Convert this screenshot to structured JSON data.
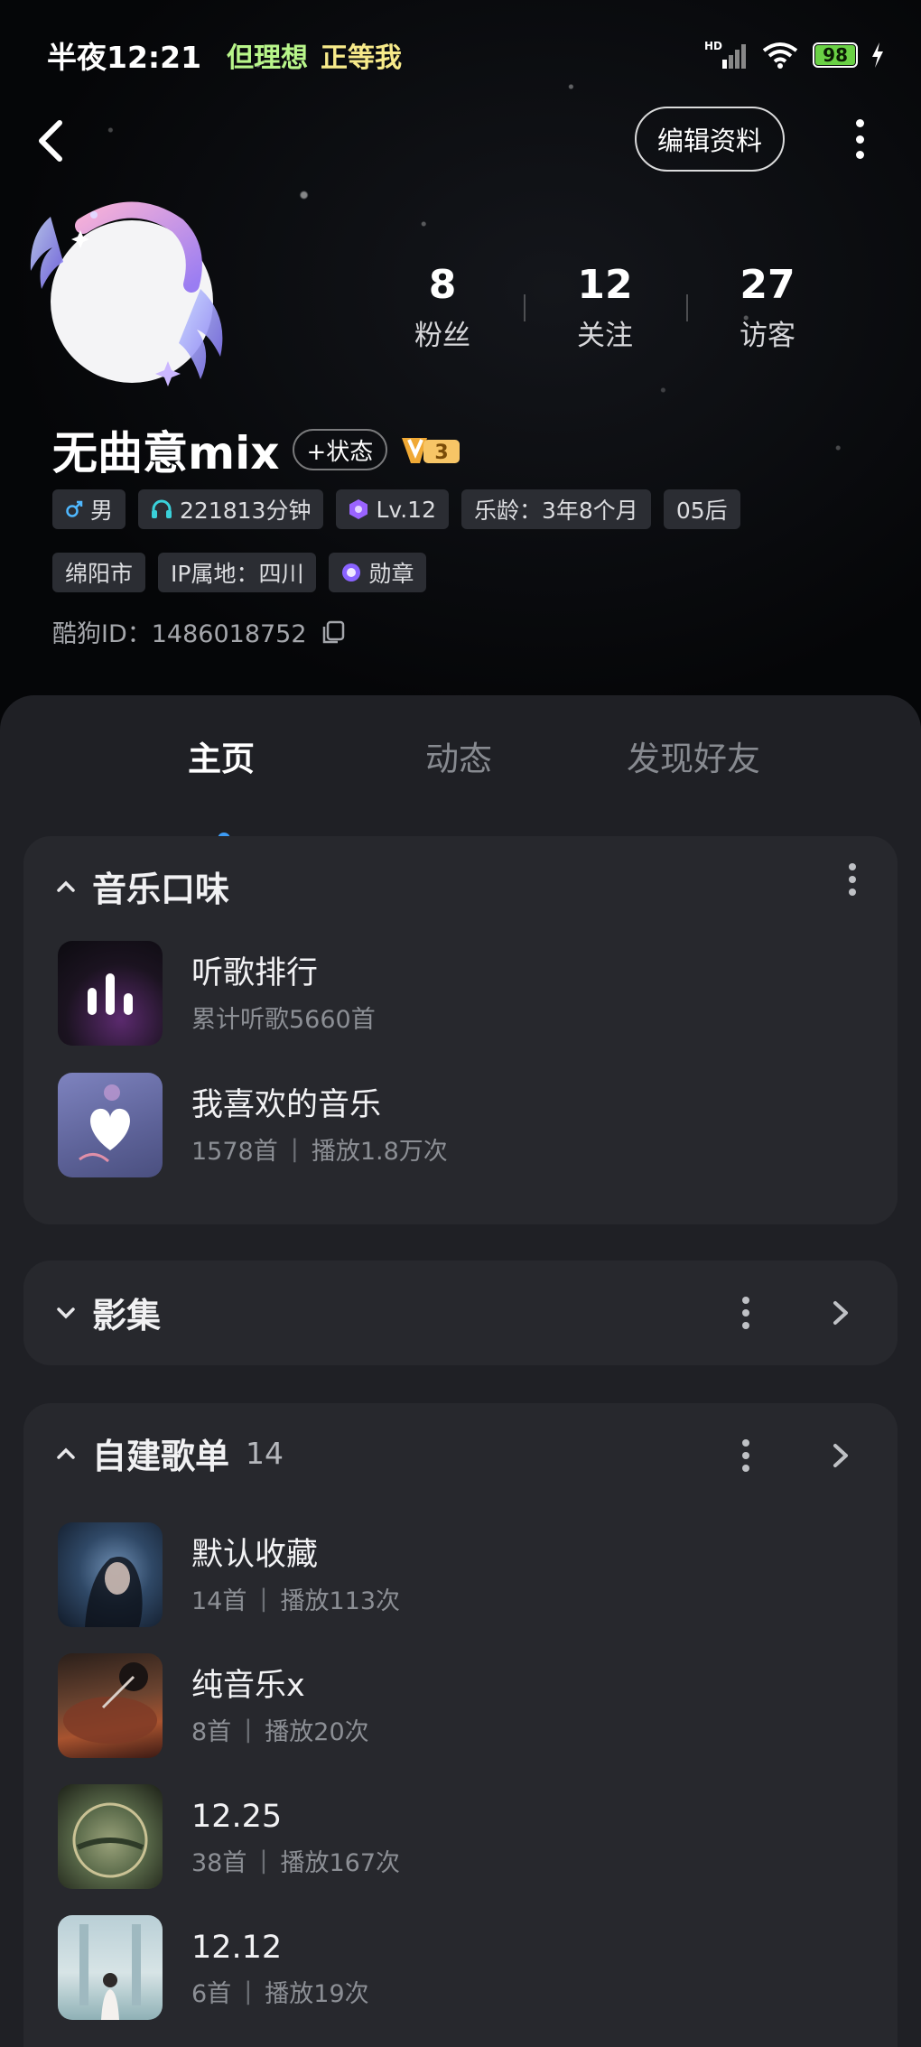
{
  "status_bar": {
    "time": "半夜12:21",
    "now_playing_part1": "但理想",
    "now_playing_part2": "正等我",
    "network": "HD",
    "battery": "98"
  },
  "header": {
    "edit_label": "编辑资料"
  },
  "stats": [
    {
      "value": "8",
      "label": "粉丝"
    },
    {
      "value": "12",
      "label": "关注"
    },
    {
      "value": "27",
      "label": "访客"
    }
  ],
  "profile": {
    "name": "无曲意mix",
    "status_chip": "+状态",
    "vip_level": "3",
    "tags_row1": [
      "男",
      "221813分钟",
      "Lv.12",
      "乐龄：3年8个月",
      "05后"
    ],
    "tags_row2": [
      "绵阳市",
      "IP属地：四川",
      "勋章"
    ],
    "kugou_id": "酷狗ID：1486018752"
  },
  "tabs": [
    "主页",
    "动态",
    "发现好友"
  ],
  "music_taste": {
    "title": "音乐口味",
    "items": [
      {
        "title": "听歌排行",
        "sub": "累计听歌5660首"
      },
      {
        "title": "我喜欢的音乐",
        "sub1": "1578首",
        "sub2": "播放1.8万次"
      }
    ]
  },
  "album": {
    "title": "影集"
  },
  "playlists": {
    "title": "自建歌单",
    "count": "14",
    "items": [
      {
        "title": "默认收藏",
        "songs": "14首",
        "plays": "播放113次"
      },
      {
        "title": "纯音乐x",
        "songs": "8首",
        "plays": "播放20次"
      },
      {
        "title": "12.25",
        "songs": "38首",
        "plays": "播放167次"
      },
      {
        "title": "12.12",
        "songs": "6首",
        "plays": "播放19次"
      }
    ]
  },
  "separator": "|",
  "colors": {
    "accent_dot": "#3d9cf5",
    "song_green": "#b8f58a",
    "song_yellow": "#f7ea8a",
    "sheet_bg": "#1f2025",
    "card_bg": "#27282d"
  }
}
